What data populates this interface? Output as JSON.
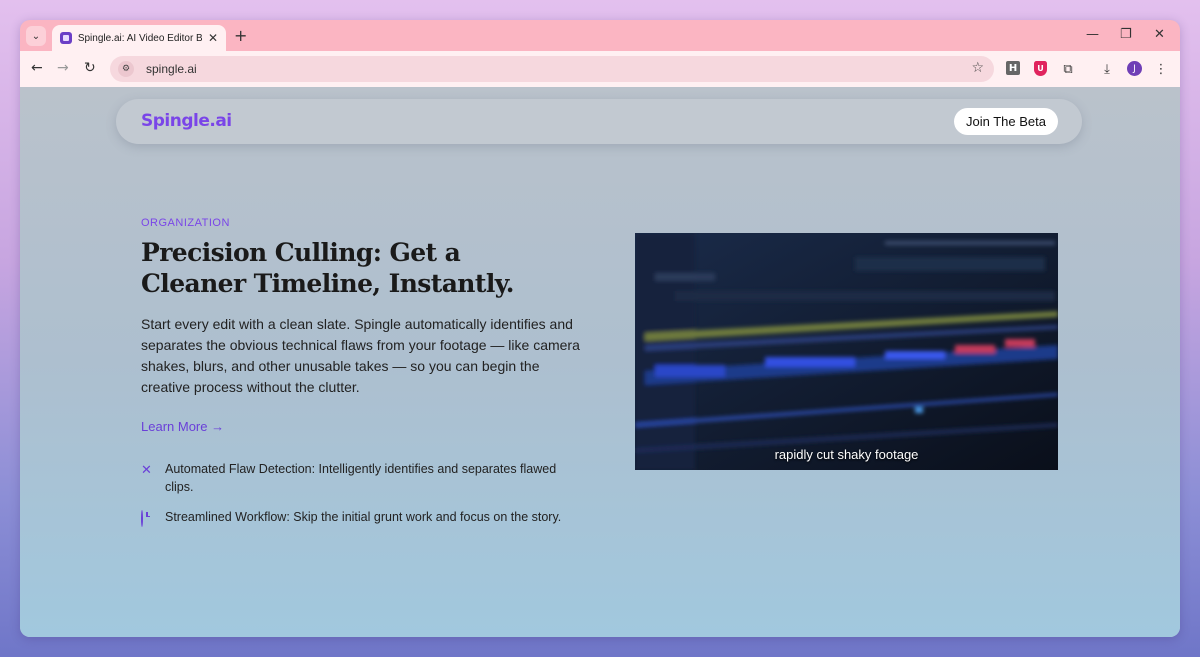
{
  "browser": {
    "tab_title": "Spingle.ai: AI Video Editor Built",
    "url": "spingle.ai",
    "profile_initial": "J",
    "ext_h_label": "H",
    "ext_shield_label": "U"
  },
  "site": {
    "logo": "Spingle.ai",
    "cta": "Join The Beta"
  },
  "section": {
    "eyebrow": "ORGANIZATION",
    "headline": "Precision Culling: Get a Cleaner Timeline, Instantly.",
    "body": "Start every edit with a clean slate. Spingle automatically identifies and separates the obvious technical flaws from your footage — like camera shakes, blurs, and other unusable takes — so you can begin the creative process without the clutter.",
    "learn_more": "Learn More →",
    "features": [
      {
        "icon": "x-icon",
        "text": "Automated Flaw Detection: Intelligently identifies and separates flawed clips."
      },
      {
        "icon": "clock-icon",
        "text": "Streamlined Workflow: Skip the initial grunt work and focus on the story."
      }
    ]
  },
  "video": {
    "caption": "rapidly cut shaky footage"
  },
  "colors": {
    "accent": "#7a45e8",
    "tab_strip": "#fbb5c2",
    "toolbar": "#fff0f2"
  }
}
